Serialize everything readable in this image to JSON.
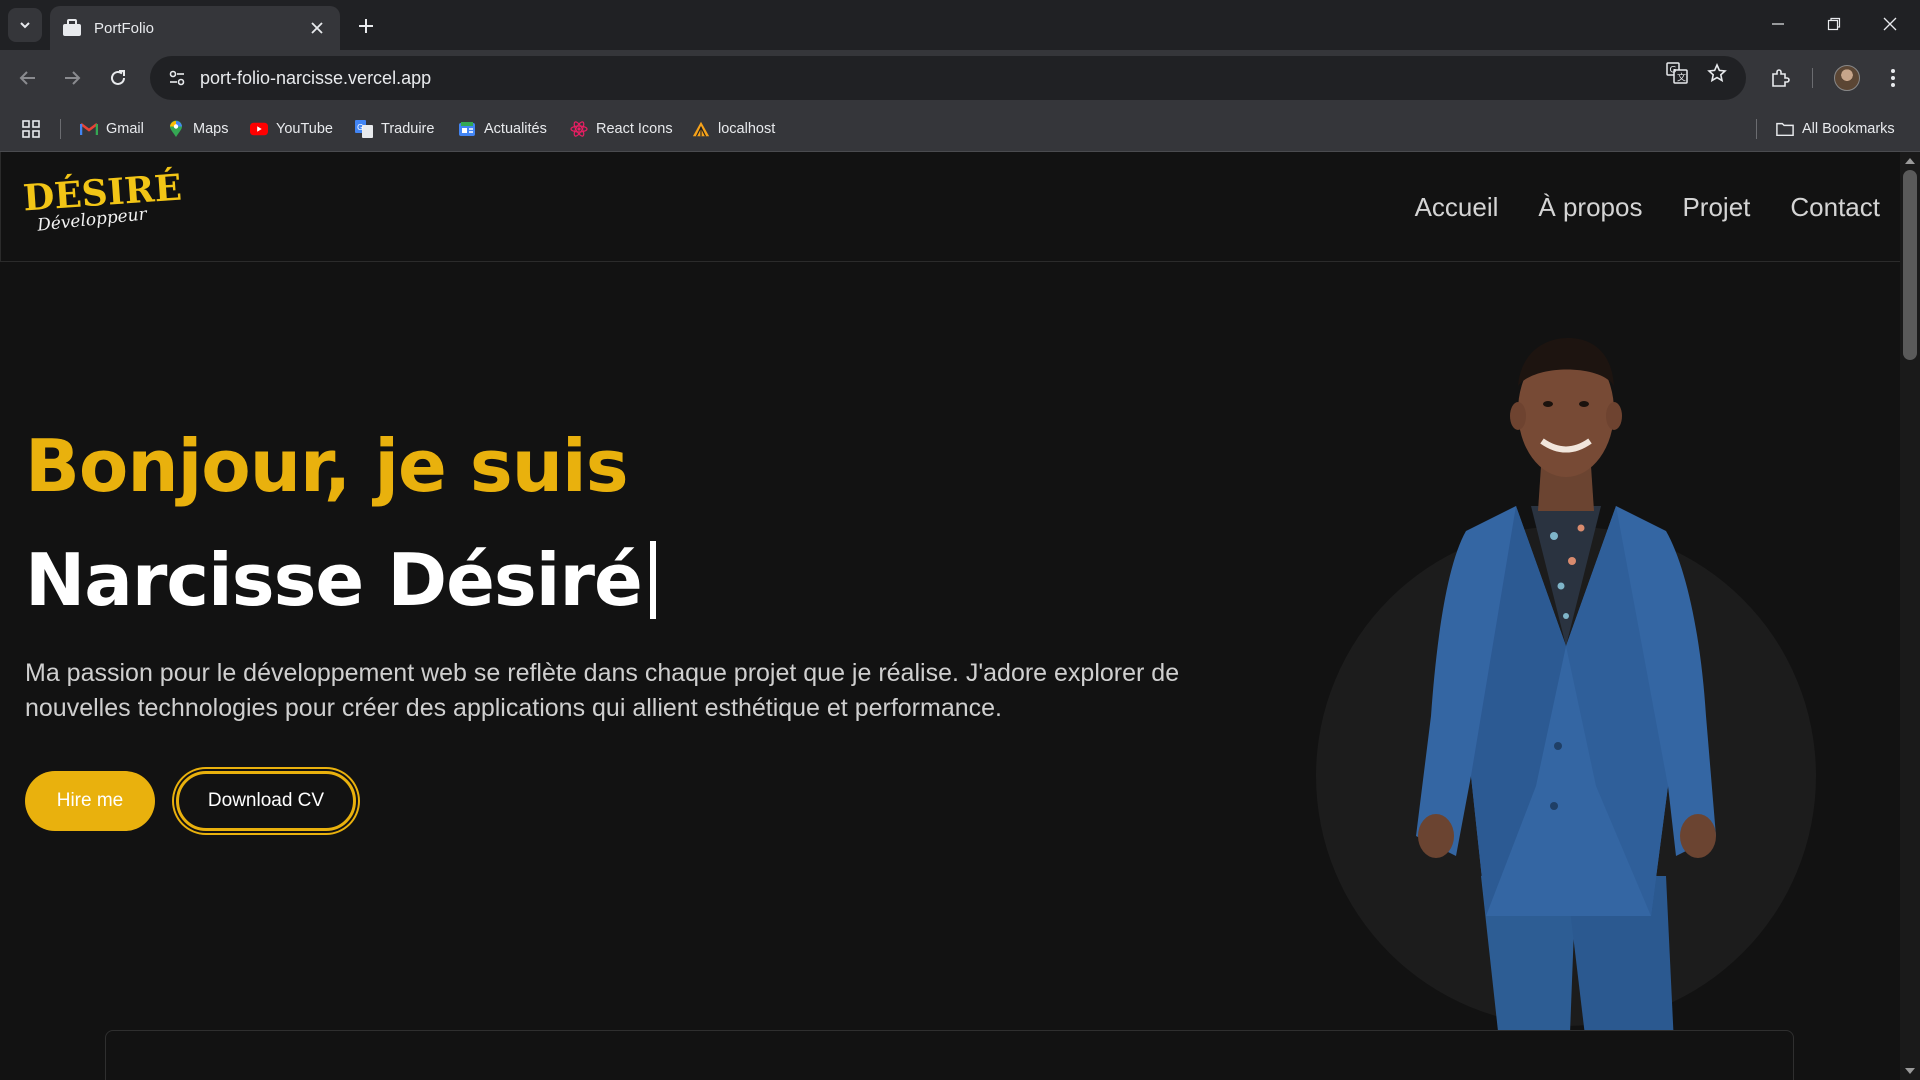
{
  "browser": {
    "tab_title": "PortFolio",
    "url": "port-folio-narcisse.vercel.app",
    "bookmarks": [
      {
        "label": "Gmail",
        "icon": "gmail-icon"
      },
      {
        "label": "Maps",
        "icon": "maps-icon"
      },
      {
        "label": "YouTube",
        "icon": "youtube-icon"
      },
      {
        "label": "Traduire",
        "icon": "translate-icon"
      },
      {
        "label": "Actualités",
        "icon": "news-icon"
      },
      {
        "label": "React Icons",
        "icon": "react-icon"
      },
      {
        "label": "localhost",
        "icon": "localhost-icon"
      }
    ],
    "all_bookmarks": "All Bookmarks"
  },
  "site": {
    "logo_main": "DÉSIRÉ",
    "logo_sub": "Développeur",
    "nav": [
      "Accueil",
      "À propos",
      "Projet",
      "Contact"
    ]
  },
  "hero": {
    "greeting": "Bonjour, je suis",
    "name": "Narcisse Désiré",
    "description": "Ma passion pour le développement web se reflète dans chaque projet que je réalise. J'adore explorer de nouvelles technologies pour créer des applications qui allient esthétique et performance.",
    "hire_button": "Hire me",
    "cv_button": "Download CV"
  },
  "colors": {
    "accent": "#e9b10d",
    "background": "#121212",
    "chrome": "#35363a"
  }
}
